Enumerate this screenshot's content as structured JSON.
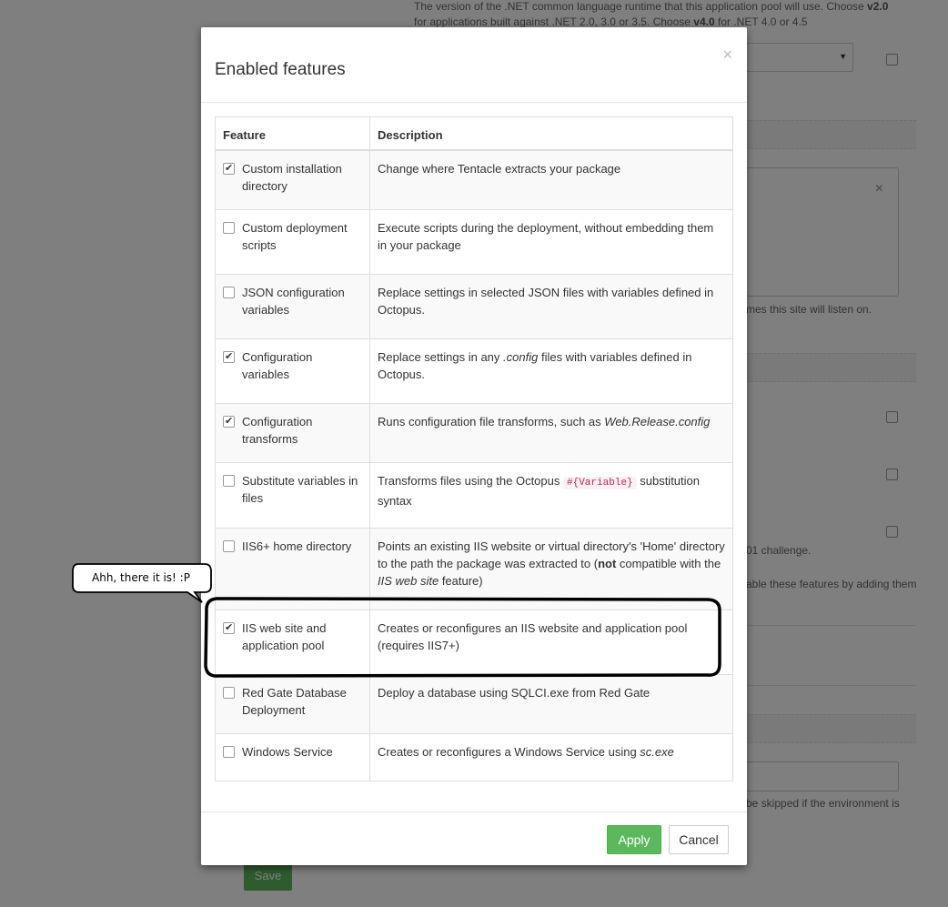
{
  "background": {
    "runtime_help": {
      "line1_prefix": "The version of the .NET common language runtime that this application pool will use. Choose ",
      "line1_bold": "v2.0",
      "line2_prefix": "for applications built against .NET 2.0, 3.0 or 3.5. Choose ",
      "line2_bold": "v4.0",
      "line2_suffix": " for .NET 4.0 or 4.5"
    },
    "bindings_help": "mes this site will listen on.",
    "challenge_text": "01 challenge.",
    "features_help": "able these features by adding them",
    "skip_help_line1": "be skipped if the environment is",
    "save_label": "Save"
  },
  "modal": {
    "title": "Enabled features",
    "close": "×",
    "columns": {
      "feature": "Feature",
      "description": "Description"
    },
    "apply_label": "Apply",
    "cancel_label": "Cancel",
    "features": [
      {
        "name": "Custom installation directory",
        "checked": true,
        "desc": "Change where Tentacle extracts your package"
      },
      {
        "name": "Custom deployment scripts",
        "checked": false,
        "desc": "Execute scripts during the deployment, without embedding them in your package"
      },
      {
        "name": "JSON configuration variables",
        "checked": false,
        "desc": "Replace settings in selected JSON files with variables defined in Octopus."
      },
      {
        "name": "Configuration variables",
        "checked": true,
        "desc_parts": [
          "Replace settings in any ",
          ".config",
          " files with variables defined in Octopus."
        ]
      },
      {
        "name": "Configuration transforms",
        "checked": true,
        "desc_parts": [
          "Runs configuration file transforms, such as ",
          "Web.Release.config",
          ""
        ]
      },
      {
        "name": "Substitute variables in files",
        "checked": false,
        "desc_parts": [
          "Transforms files using the Octopus ",
          "#{Variable}",
          " substitution syntax"
        ]
      },
      {
        "name": "IIS6+ home directory",
        "checked": false,
        "desc_parts": [
          "Points an existing IIS website or virtual directory's 'Home' directory to the path the package was extracted to (",
          "not",
          " compatible with the ",
          "IIS web site",
          " feature)"
        ]
      },
      {
        "name": "IIS web site and application pool",
        "checked": true,
        "desc": "Creates or reconfigures an IIS website and application pool (requires IIS7+)"
      },
      {
        "name": "Red Gate Database Deployment",
        "checked": false,
        "desc": "Deploy a database using SQLCI.exe from Red Gate"
      },
      {
        "name": "Windows Service",
        "checked": false,
        "desc_parts": [
          "Creates or reconfigures a Windows Service using ",
          "sc.exe",
          ""
        ]
      }
    ]
  },
  "annotation": {
    "bubble_text": "Ahh, there it is!  :P"
  }
}
